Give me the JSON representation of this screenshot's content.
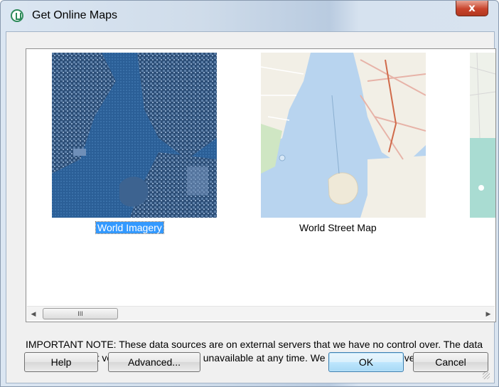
{
  "window": {
    "title": "Get Online Maps",
    "close_glyph": "x"
  },
  "gallery": {
    "items": [
      {
        "label": "World Imagery",
        "selected": true
      },
      {
        "label": "World Street Map",
        "selected": false
      },
      {
        "label": "",
        "selected": false
      }
    ],
    "scrollbar": {
      "left_glyph": "◀",
      "right_glyph": "▶",
      "thumb_glyph": "III"
    }
  },
  "note": "IMPORTANT NOTE: These data sources are on external servers that we have no control over. The data may draw/export very slowly or become unavailable at any time. We have no control over this.",
  "buttons": {
    "help": "Help",
    "advanced": "Advanced...",
    "ok": "OK",
    "cancel": "Cancel"
  },
  "colors": {
    "selection": "#3399ff",
    "close_red": "#c8442c",
    "water_street": "#b8d4ef",
    "imagery": "#2a5a8c"
  }
}
